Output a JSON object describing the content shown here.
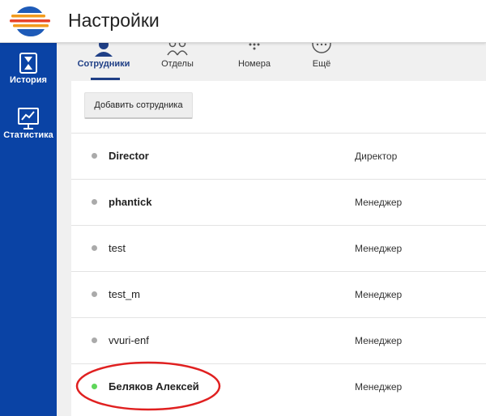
{
  "header": {
    "title": "Настройки",
    "logo_colors": [
      "#1e5bb8",
      "#f29b1d",
      "#e8452c"
    ]
  },
  "sidebar": {
    "background": "#0a43a5",
    "items": [
      {
        "label": "История",
        "icon": "hourglass-icon"
      },
      {
        "label": "Статистика",
        "icon": "chart-board-icon"
      }
    ]
  },
  "tabs": [
    {
      "label": "Сотрудники",
      "icon": "person-icon",
      "active": true
    },
    {
      "label": "Отделы",
      "icon": "group-icon",
      "active": false
    },
    {
      "label": "Номера",
      "icon": "dialpad-icon",
      "active": false
    },
    {
      "label": "Ещё",
      "icon": "more-icon",
      "active": false
    }
  ],
  "actions": {
    "add_employee": "Добавить сотрудника"
  },
  "employees": [
    {
      "name": "Director",
      "role": "Директор",
      "bold": true,
      "online": false
    },
    {
      "name": "phantick",
      "role": "Менеджер",
      "bold": true,
      "online": false
    },
    {
      "name": "test",
      "role": "Менеджер",
      "bold": false,
      "online": false
    },
    {
      "name": "test_m",
      "role": "Менеджер",
      "bold": false,
      "online": false
    },
    {
      "name": "vvuri-enf",
      "role": "Менеджер",
      "bold": false,
      "online": false
    },
    {
      "name": "Беляков Алексей",
      "role": "Менеджер",
      "bold": true,
      "online": true
    }
  ],
  "colors": {
    "accent": "#1f3f86",
    "online": "#5fd65a",
    "offline": "#aaaaaa",
    "annotation": "#e02020"
  }
}
